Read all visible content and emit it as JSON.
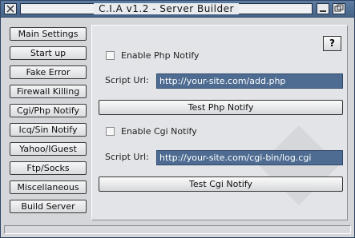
{
  "window": {
    "title": "C.I.A  v1.2 - Server Builder"
  },
  "sidebar": {
    "items": [
      {
        "label": "Main Settings"
      },
      {
        "label": "Start up"
      },
      {
        "label": "Fake Error"
      },
      {
        "label": "Firewall Killing"
      },
      {
        "label": "Cgi/Php Notify"
      },
      {
        "label": "Icq/Sin Notify"
      },
      {
        "label": "Yahoo/IGuest"
      },
      {
        "label": "Ftp/Socks"
      },
      {
        "label": "Miscellaneous"
      },
      {
        "label": "Build Server"
      }
    ]
  },
  "panel": {
    "help_label": "?",
    "php": {
      "checkbox_label": "Enable Php Notify",
      "checked": false,
      "url_label": "Script Url:",
      "url_value": "http://your-site.com/add.php",
      "test_label": "Test Php Notify"
    },
    "cgi": {
      "checkbox_label": "Enable Cgi Notify",
      "checked": false,
      "url_label": "Script Url:",
      "url_value": "http://your-site.com/cgi-bin/log.cgi",
      "test_label": "Test Cgi Notify"
    }
  },
  "icons": {
    "close": "close-icon",
    "minimize": "minimize-icon",
    "maximize": "maximize-icon"
  }
}
